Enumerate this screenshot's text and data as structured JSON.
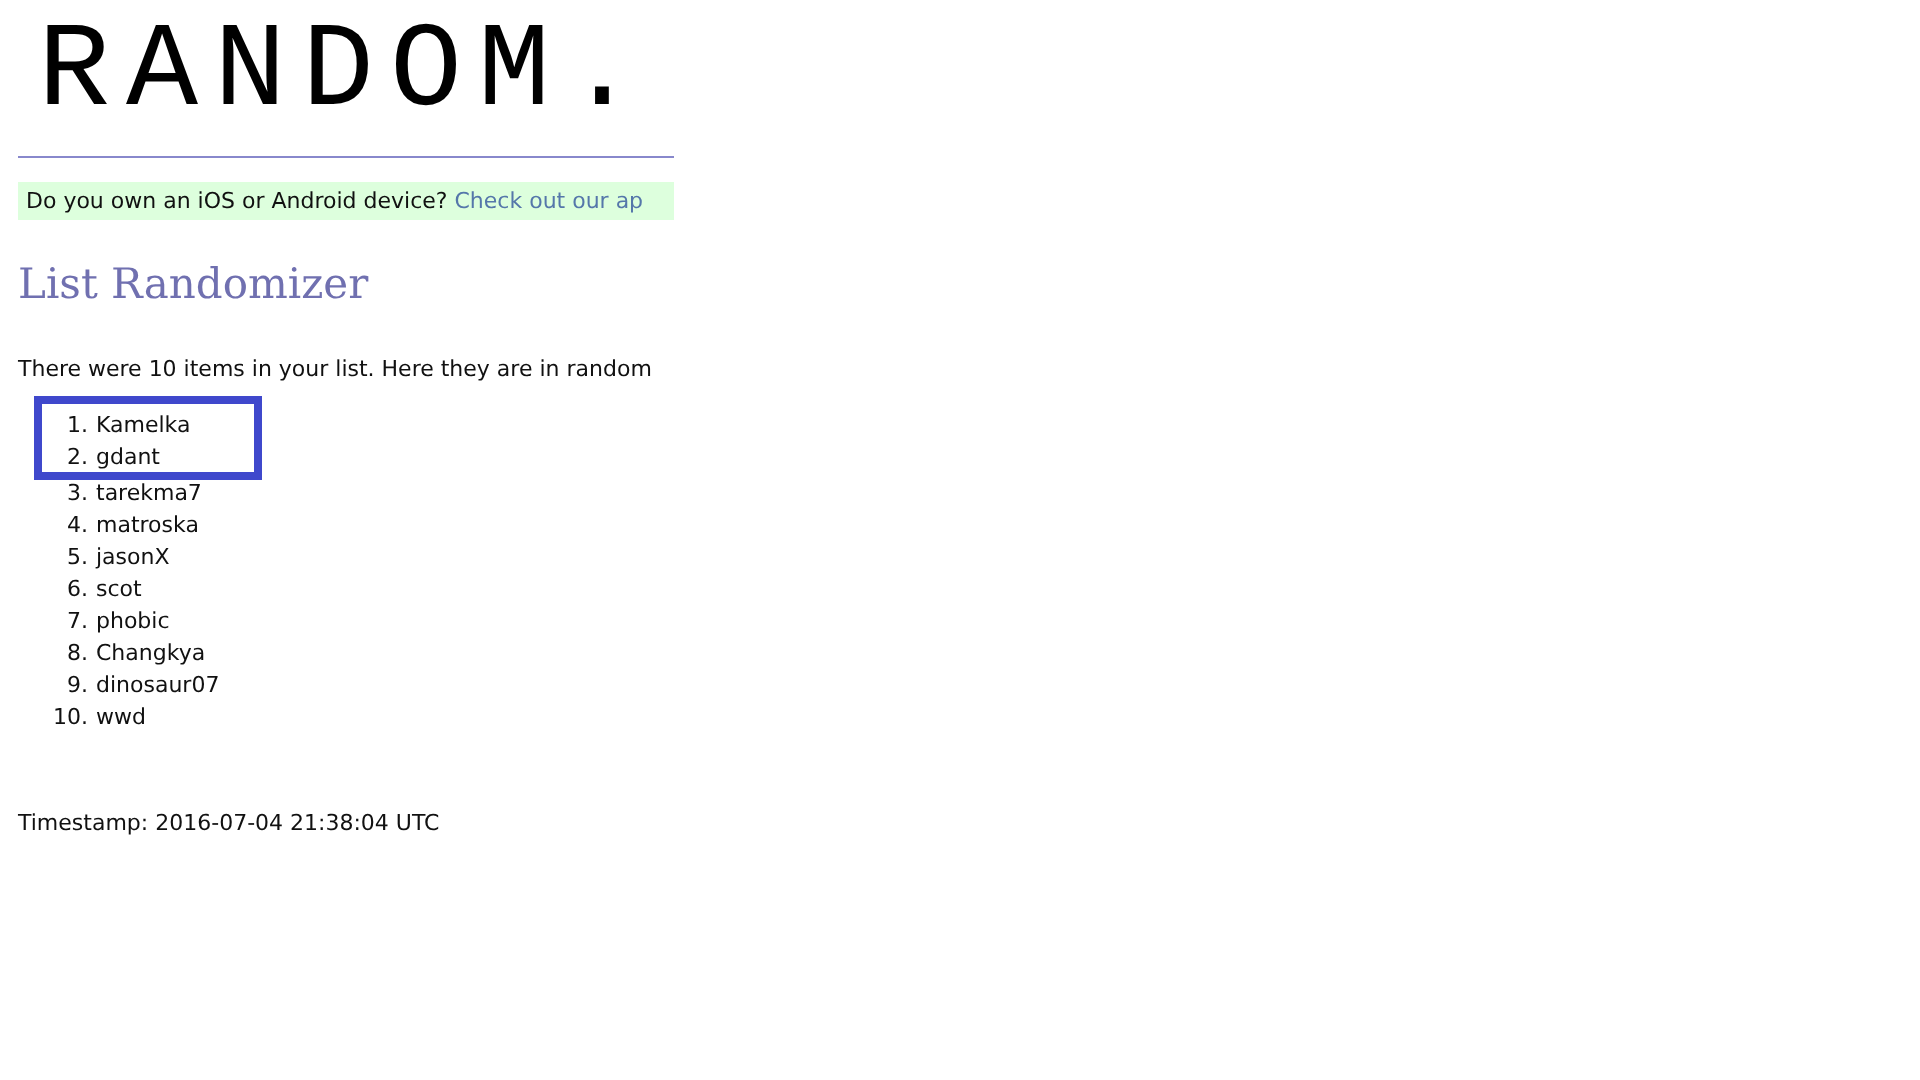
{
  "logo": "RANDOM.",
  "banner": {
    "text": "Do you own an iOS or Android device?",
    "link": "Check out our ap"
  },
  "title": "List Randomizer",
  "intro": "There were 10 items in your list. Here they are in random",
  "items": [
    {
      "number": "1.",
      "name": "Kamelka"
    },
    {
      "number": "2.",
      "name": "gdant"
    },
    {
      "number": "3.",
      "name": "tarekma7"
    },
    {
      "number": "4.",
      "name": "matroska"
    },
    {
      "number": "5.",
      "name": "jasonX"
    },
    {
      "number": "6.",
      "name": "scot"
    },
    {
      "number": "7.",
      "name": "phobic"
    },
    {
      "number": "8.",
      "name": "Changkya"
    },
    {
      "number": "9.",
      "name": "dinosaur07"
    },
    {
      "number": "10.",
      "name": "wwd"
    }
  ],
  "timestamp": "Timestamp: 2016-07-04 21:38:04 UTC"
}
